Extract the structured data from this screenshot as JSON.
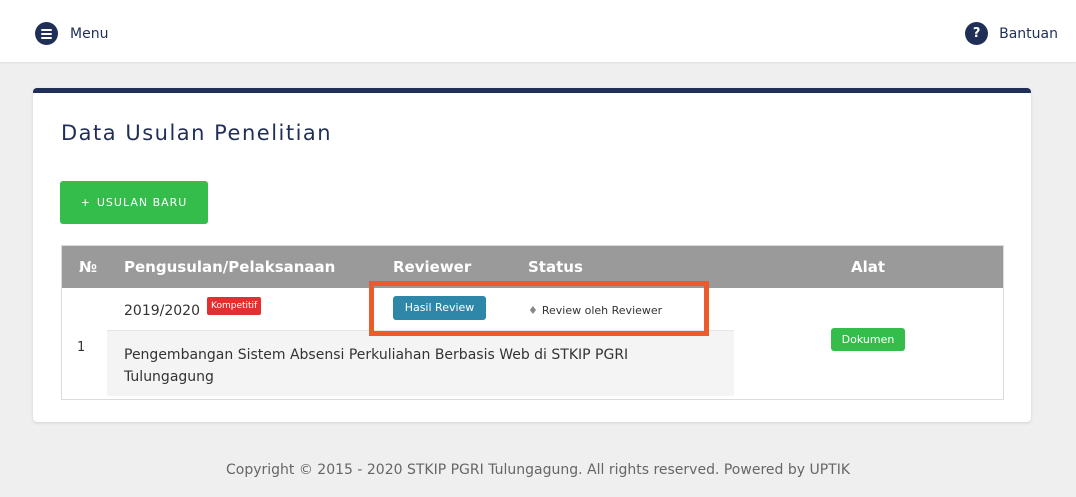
{
  "topbar": {
    "menu_label": "Menu",
    "help_label": "Bantuan",
    "menu_icon": "hamburger-icon",
    "help_icon": "question-circle-icon",
    "help_glyph": "?",
    "icon_color": "#1f2f57"
  },
  "main": {
    "title": "Data Usulan Penelitian",
    "new_button_plus": "+",
    "new_button_label": "USULAN BARU",
    "table": {
      "headers": {
        "no": "№",
        "pengusulan": "Pengusulan/Pelaksanaan",
        "reviewer": "Reviewer",
        "status": "Status",
        "alat": "Alat"
      },
      "rows": [
        {
          "no": "1",
          "period": "2019/2020",
          "badge": "Kompetitif",
          "reviewer_button": "Hasil Review",
          "status_bullet": "♦",
          "status": "Review oleh Reviewer",
          "title": "Pengembangan Sistem Absensi Perkuliahan Berbasis Web di STKIP PGRI Tulungagung",
          "tool_button": "Dokumen"
        }
      ]
    }
  },
  "colors": {
    "navy": "#1f2f57",
    "green": "#35bd4b",
    "badge_red": "#e22f2f",
    "review_blue": "#2e87a8",
    "highlight_orange": "#ee5b2b",
    "header_gray": "#9a9a9a"
  },
  "footer": {
    "text": "Copyright © 2015 - 2020 STKIP PGRI Tulungagung. All rights reserved. Powered by UPTIK"
  }
}
